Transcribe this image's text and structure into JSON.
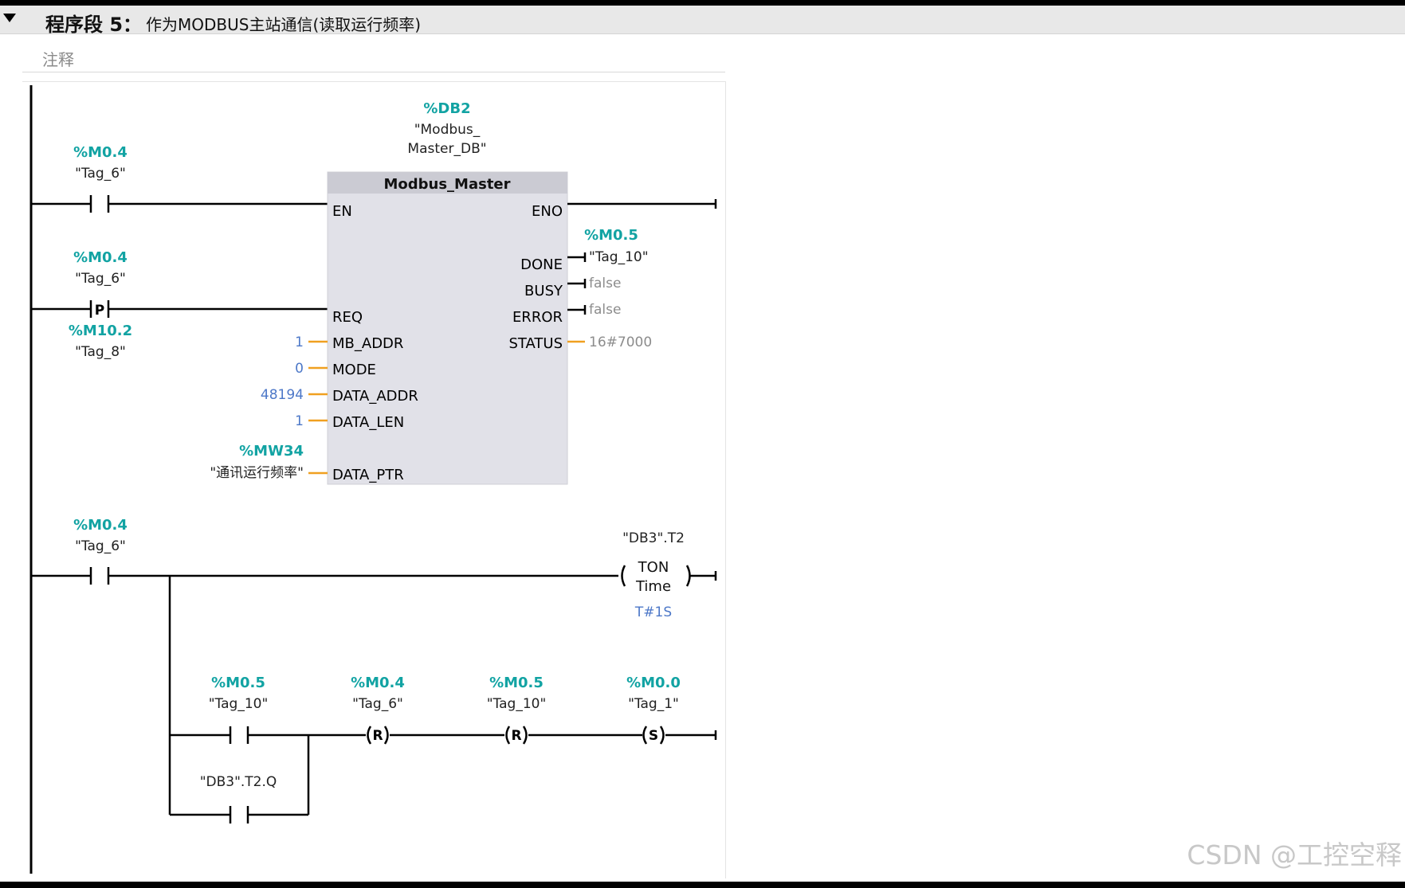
{
  "segment": {
    "label": "程序段 5：",
    "title": "作为MODBUS主站通信(读取运行频率)",
    "comment_placeholder": "注释"
  },
  "block": {
    "instance_address": "%DB2",
    "instance_name_line1": "\"Modbus_",
    "instance_name_line2": "Master_DB\"",
    "type": "Modbus_Master",
    "inputs": {
      "en": "EN",
      "req": "REQ",
      "mb_addr": "MB_ADDR",
      "mode": "MODE",
      "data_addr": "DATA_ADDR",
      "data_len": "DATA_LEN",
      "data_ptr": "DATA_PTR"
    },
    "outputs": {
      "eno": "ENO",
      "done": "DONE",
      "busy": "BUSY",
      "error": "ERROR",
      "status": "STATUS"
    },
    "input_values": {
      "mb_addr": "1",
      "mode": "0",
      "data_addr": "48194",
      "data_len": "1",
      "data_ptr_addr": "%MW34",
      "data_ptr_tag": "\"通讯运行频率\""
    },
    "output_values": {
      "done_addr": "%M0.5",
      "done_tag": "\"Tag_10\"",
      "busy": "false",
      "error": "false",
      "status": "16#7000"
    }
  },
  "rung1": {
    "contact1": {
      "address": "%M0.4",
      "tag": "\"Tag_6\""
    },
    "pcontact": {
      "address": "%M0.4",
      "tag": "\"Tag_6\"",
      "symbol": "P",
      "edge_address": "%M10.2",
      "edge_tag": "\"Tag_8\""
    }
  },
  "rung2": {
    "contact": {
      "address": "%M0.4",
      "tag": "\"Tag_6\""
    },
    "timer": {
      "instance": "\"DB3\".T2",
      "type": "TON",
      "subtype": "Time",
      "preset": "T#1S"
    },
    "branch_contact1": {
      "address": "%M0.5",
      "tag": "\"Tag_10\""
    },
    "branch_contact2": {
      "tag": "\"DB3\".T2.Q"
    },
    "coil1": {
      "address": "%M0.4",
      "tag": "\"Tag_6\"",
      "symbol": "R"
    },
    "coil2": {
      "address": "%M0.5",
      "tag": "\"Tag_10\"",
      "symbol": "R"
    },
    "coil3": {
      "address": "%M0.0",
      "tag": "\"Tag_1\"",
      "symbol": "S"
    }
  },
  "watermark": "CSDN @工控空释",
  "colors": {
    "address": "#12a3a3",
    "constant": "#4d78c8",
    "wire_param": "#f0a020",
    "block_fill": "#e1e1e8"
  }
}
